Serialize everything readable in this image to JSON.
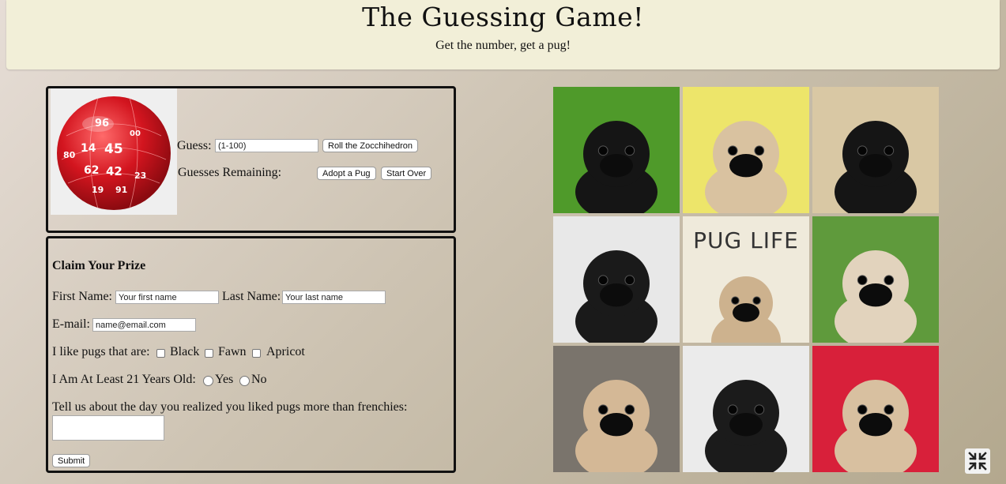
{
  "header": {
    "title": "The Guessing Game!",
    "subtitle": "Get the number, get a pug!"
  },
  "game": {
    "guess_label": "Guess:",
    "guess_placeholder": "(1-100)",
    "roll_button": "Roll the Zocchihedron",
    "remaining_label": "Guesses Remaining:",
    "adopt_button": "Adopt a Pug",
    "startover_button": "Start Over",
    "dice_numbers": [
      "96",
      "14",
      "45",
      "62",
      "42",
      "19",
      "91",
      "23",
      "80",
      "00"
    ]
  },
  "prize": {
    "heading": "Claim Your Prize",
    "first_name_label": "First Name:",
    "first_name_placeholder": "Your first name",
    "last_name_label": "Last Name:",
    "last_name_placeholder": "Your last name",
    "email_label": "E-mail:",
    "email_placeholder": "name@email.com",
    "likes_label": "I like pugs that are:",
    "likes_options": [
      "Black",
      "Fawn",
      "Apricot"
    ],
    "age_label": "I Am At Least 21 Years Old:",
    "age_options": [
      "Yes",
      "No"
    ],
    "story_label": "Tell us about the day you realized you liked pugs more than frenchies:",
    "submit_button": "Submit"
  },
  "gallery": {
    "pug_life_text": "PUG LIFE",
    "tiles": [
      {
        "name": "black-pug-grass-photo",
        "bg": "#4f9a2a"
      },
      {
        "name": "fawn-pug-yellow-toy-photo",
        "bg": "#ede56a"
      },
      {
        "name": "black-pug-tongue-photo",
        "bg": "#d9c8a4"
      },
      {
        "name": "black-pug-tilted-head-photo",
        "bg": "#e8e8e8"
      },
      {
        "name": "pug-life-hoodie-photo",
        "bg": "#efeadb"
      },
      {
        "name": "fawn-puppy-grass-photo",
        "bg": "#5f9a3c"
      },
      {
        "name": "pug-fence-photo",
        "bg": "#7a746c"
      },
      {
        "name": "pug-party-hat-arm-photo",
        "bg": "#ebebeb"
      },
      {
        "name": "pug-bowtie-red-photo",
        "bg": "#d8203a"
      }
    ]
  },
  "icons": {
    "minimize": "minimize-icon"
  }
}
